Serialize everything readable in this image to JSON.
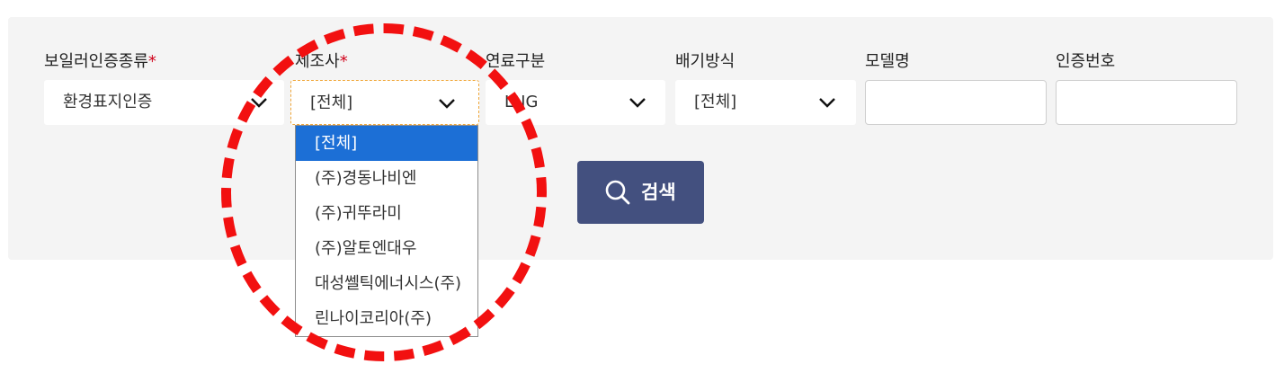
{
  "filters": {
    "cert_type": {
      "label": "보일러인증종류",
      "required_mark": "*",
      "value": "환경표지인증"
    },
    "manufacturer": {
      "label": "제조사",
      "required_mark": "*",
      "value": "[전체]"
    },
    "fuel": {
      "label": "연료구분",
      "value": "LNG"
    },
    "exhaust": {
      "label": "배기방식",
      "value": "[전체]"
    },
    "model": {
      "label": "모델명",
      "value": ""
    },
    "cert_no": {
      "label": "인증번호",
      "value": ""
    }
  },
  "manufacturer_options": [
    "[전체]",
    "(주)경동나비엔",
    "(주)귀뚜라미",
    "(주)알토엔대우",
    "대성쎌틱에너시스(주)",
    "린나이코리아(주)"
  ],
  "selected_option_index": 0,
  "search_button": {
    "label": "검색",
    "icon": "search-icon"
  },
  "colors": {
    "panel_bg": "#f4f4f4",
    "required_mark": "#d0021b",
    "dropdown_selected": "#1c6fd6",
    "search_button": "#43507f",
    "annotation_circle": "#f21010",
    "focus_border": "#f0a73a"
  }
}
